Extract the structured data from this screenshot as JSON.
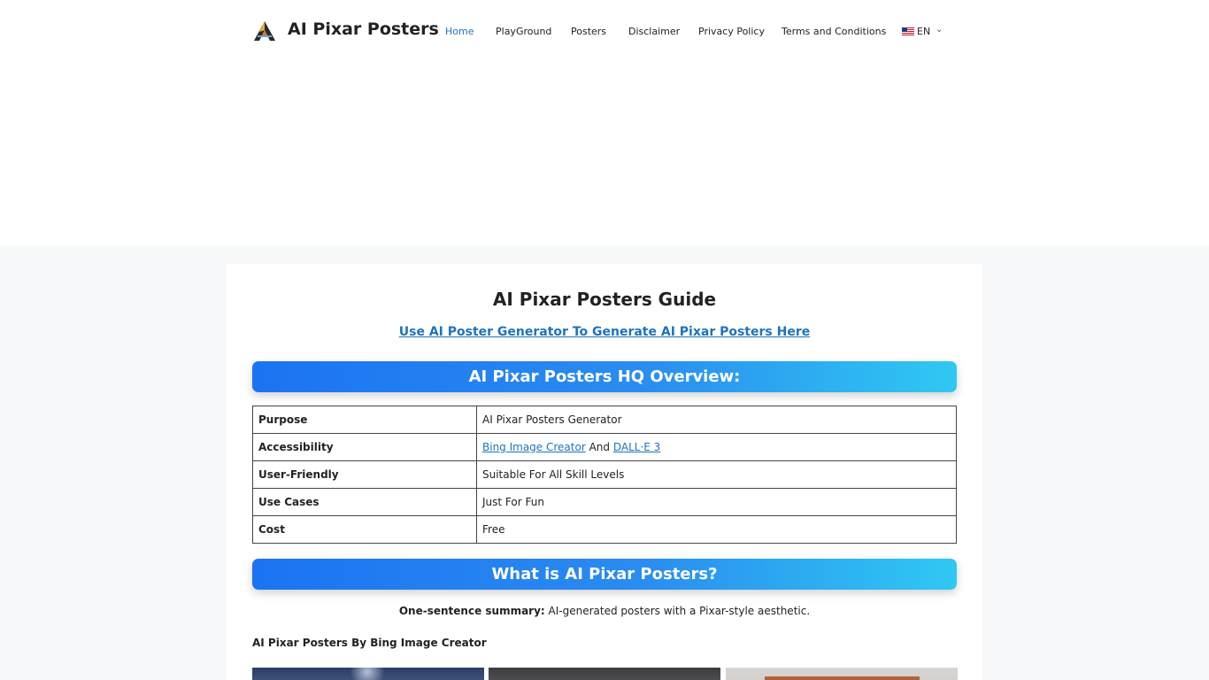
{
  "site": {
    "title": "AI Pixar Posters",
    "logo_icon": "ai-pixar-logo-icon"
  },
  "nav": {
    "items": [
      {
        "label": "Home",
        "active": true
      },
      {
        "label": "PlayGround",
        "active": false
      },
      {
        "label": "Posters",
        "active": false
      },
      {
        "label": "Disclaimer",
        "active": false
      },
      {
        "label": "Privacy Policy",
        "active": false
      },
      {
        "label": "Terms and Conditions",
        "active": false
      }
    ],
    "language": {
      "label": "EN",
      "flag_icon": "us-flag-icon",
      "chevron_icon": "chevron-down-icon"
    }
  },
  "main": {
    "title": "AI Pixar Posters Guide",
    "cta_link": "Use AI Poster Generator To Generate AI Pixar Posters Here",
    "overview_heading": "AI Pixar Posters HQ Overview:",
    "overview_rows": [
      {
        "key": "Purpose",
        "value": "AI Pixar Posters Generator"
      },
      {
        "key": "Accessibility",
        "link1": "Bing Image Creator",
        "joiner": "And",
        "link2": "DALL·E 3"
      },
      {
        "key": "User-Friendly",
        "value": "Suitable For All Skill Levels"
      },
      {
        "key": "Use Cases",
        "value": "Just For Fun"
      },
      {
        "key": "Cost",
        "value": "Free"
      }
    ],
    "what_is_heading": "What is AI Pixar Posters?",
    "summary_label": "One-sentence summary:",
    "summary_text": "AI-generated posters with a Pixar-style aesthetic.",
    "gallery_heading": "AI Pixar Posters By Bing Image Creator"
  },
  "colors": {
    "link": "#1e73be",
    "banner_start": "#1c73f2",
    "banner_end": "#30c8f2"
  }
}
